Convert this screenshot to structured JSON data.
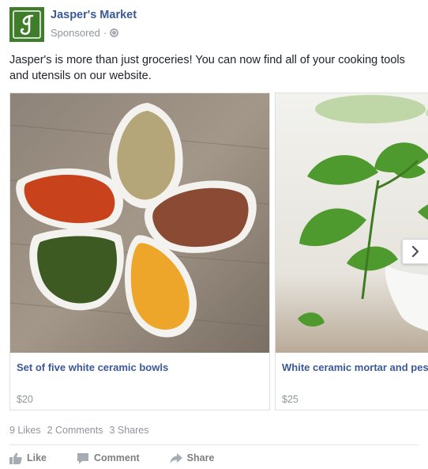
{
  "post": {
    "page_name": "Jasper's Market",
    "sponsored_label": "Sponsored",
    "separator": "·",
    "message": "Jasper's is more than just groceries! You can now find all of your cooking tools and utensils on our website.",
    "logo_icon": "jaspers-market-logo",
    "brand_color": "#3f7d2a",
    "link_color": "#3b5998"
  },
  "carousel": {
    "cards": [
      {
        "title": "Set of five white ceramic bowls",
        "price": "$20",
        "image": "spice-bowls-image"
      },
      {
        "title": "White ceramic mortar and pestle",
        "price": "$25",
        "image": "mint-mortar-image"
      }
    ],
    "next_icon": "chevron-right-icon"
  },
  "stats": {
    "likes": "9 Likes",
    "comments": "2 Comments",
    "shares": "3 Shares"
  },
  "actions": {
    "like": "Like",
    "comment": "Comment",
    "share": "Share"
  }
}
